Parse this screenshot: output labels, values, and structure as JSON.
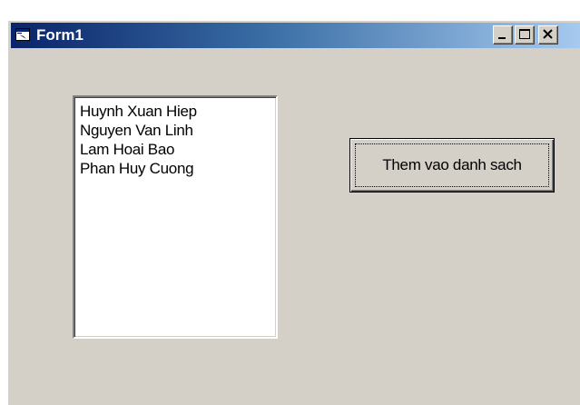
{
  "window": {
    "title": "Form1",
    "icon": "form-window-icon",
    "controls": {
      "minimize_icon": "minimize-icon",
      "maximize_icon": "maximize-icon",
      "close_icon": "close-icon"
    }
  },
  "listbox": {
    "items": [
      "Huynh Xuan Hiep",
      "Nguyen Van Linh",
      "Lam Hoai Bao",
      "Phan Huy Cuong"
    ]
  },
  "add_button": {
    "label": "Them vao danh sach"
  },
  "colors": {
    "titlebar_start": "#0a246a",
    "titlebar_end": "#a6caf0",
    "face": "#d4d0c8"
  }
}
